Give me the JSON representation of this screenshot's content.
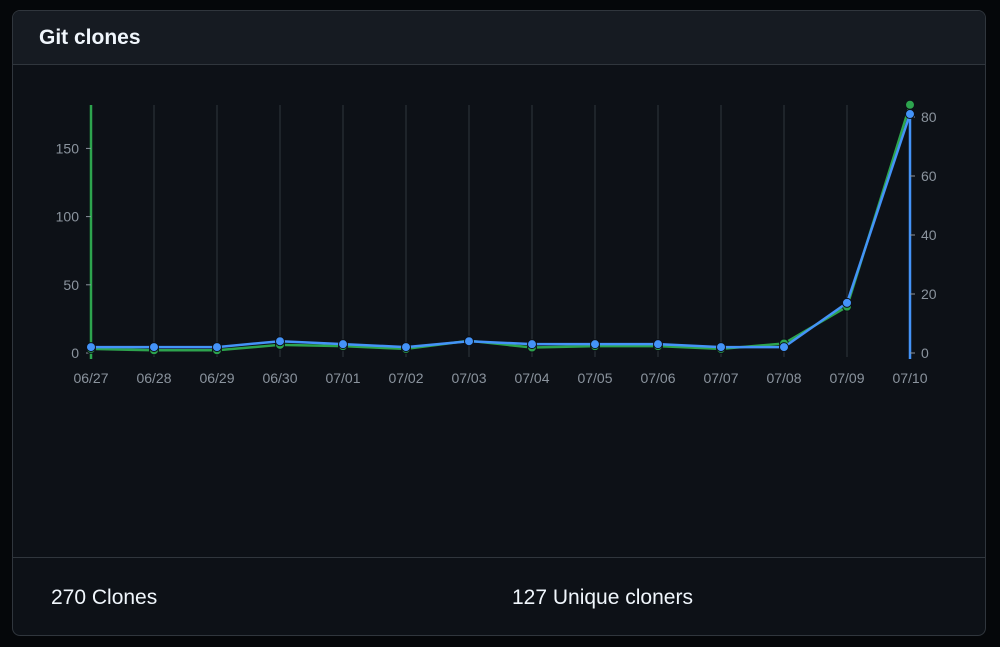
{
  "panel": {
    "title": "Git clones"
  },
  "summary": {
    "clones_label": "270 Clones",
    "unique_label": "127 Unique cloners"
  },
  "colors": {
    "clones": "#2da44e",
    "unique": "#4493f8",
    "grid": "#30363d",
    "tick": "#8b949e"
  },
  "chart_data": {
    "type": "line",
    "title": "",
    "categories": [
      "06/27",
      "06/28",
      "06/29",
      "06/30",
      "07/01",
      "07/02",
      "07/03",
      "07/04",
      "07/05",
      "07/06",
      "07/07",
      "07/08",
      "07/09",
      "07/10"
    ],
    "series": [
      {
        "key": "clones",
        "axis": "left",
        "values": [
          3,
          2,
          2,
          6,
          5,
          3,
          9,
          4,
          5,
          5,
          3,
          7,
          34,
          182
        ]
      },
      {
        "key": "unique",
        "axis": "right",
        "values": [
          2,
          2,
          2,
          4,
          3,
          2,
          4,
          3,
          3,
          3,
          2,
          2,
          17,
          81
        ]
      }
    ],
    "y_left": {
      "ticks": [
        0,
        50,
        100,
        150
      ],
      "range": [
        0,
        175
      ]
    },
    "y_right": {
      "ticks": [
        0,
        20,
        40,
        60,
        80
      ],
      "range": [
        0,
        80
      ]
    },
    "grid": "vertical",
    "legend": "none"
  }
}
